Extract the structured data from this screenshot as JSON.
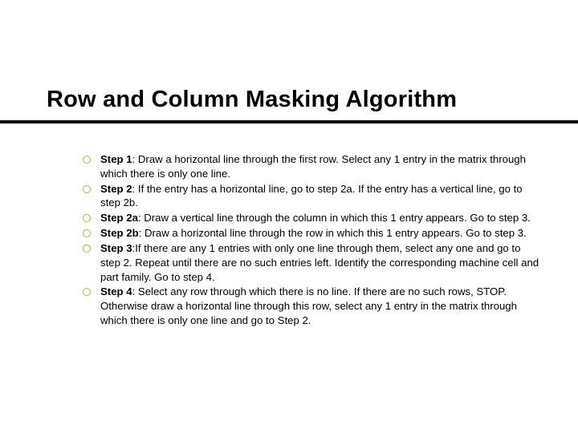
{
  "title": "Row and Column Masking Algorithm",
  "steps": [
    {
      "label": "Step 1",
      "text": ": Draw a horizontal line through the first row. Select any 1 entry in the matrix through which there is only one line."
    },
    {
      "label": "Step 2",
      "text": ": If the entry has a horizontal line, go to step 2a. If the entry has a vertical line, go to step 2b."
    },
    {
      "label": "Step 2a",
      "text": ": Draw a vertical line through the column in which this 1 entry appears. Go to step 3."
    },
    {
      "label": "Step 2b",
      "text": ": Draw a horizontal line through the row in which this 1 entry appears. Go to step 3."
    },
    {
      "label": "Step 3",
      "text": ":If there are any 1 entries with only one line through them, select any one and go to step 2. Repeat until there are no such entries left. Identify the corresponding machine cell and part family. Go to step 4."
    },
    {
      "label": "Step 4",
      "text": ": Select any row through which there is no line. If there are no such rows, STOP. Otherwise draw a horizontal line through this row, select any 1 entry in the matrix through which there is only one line and go to Step 2."
    }
  ]
}
